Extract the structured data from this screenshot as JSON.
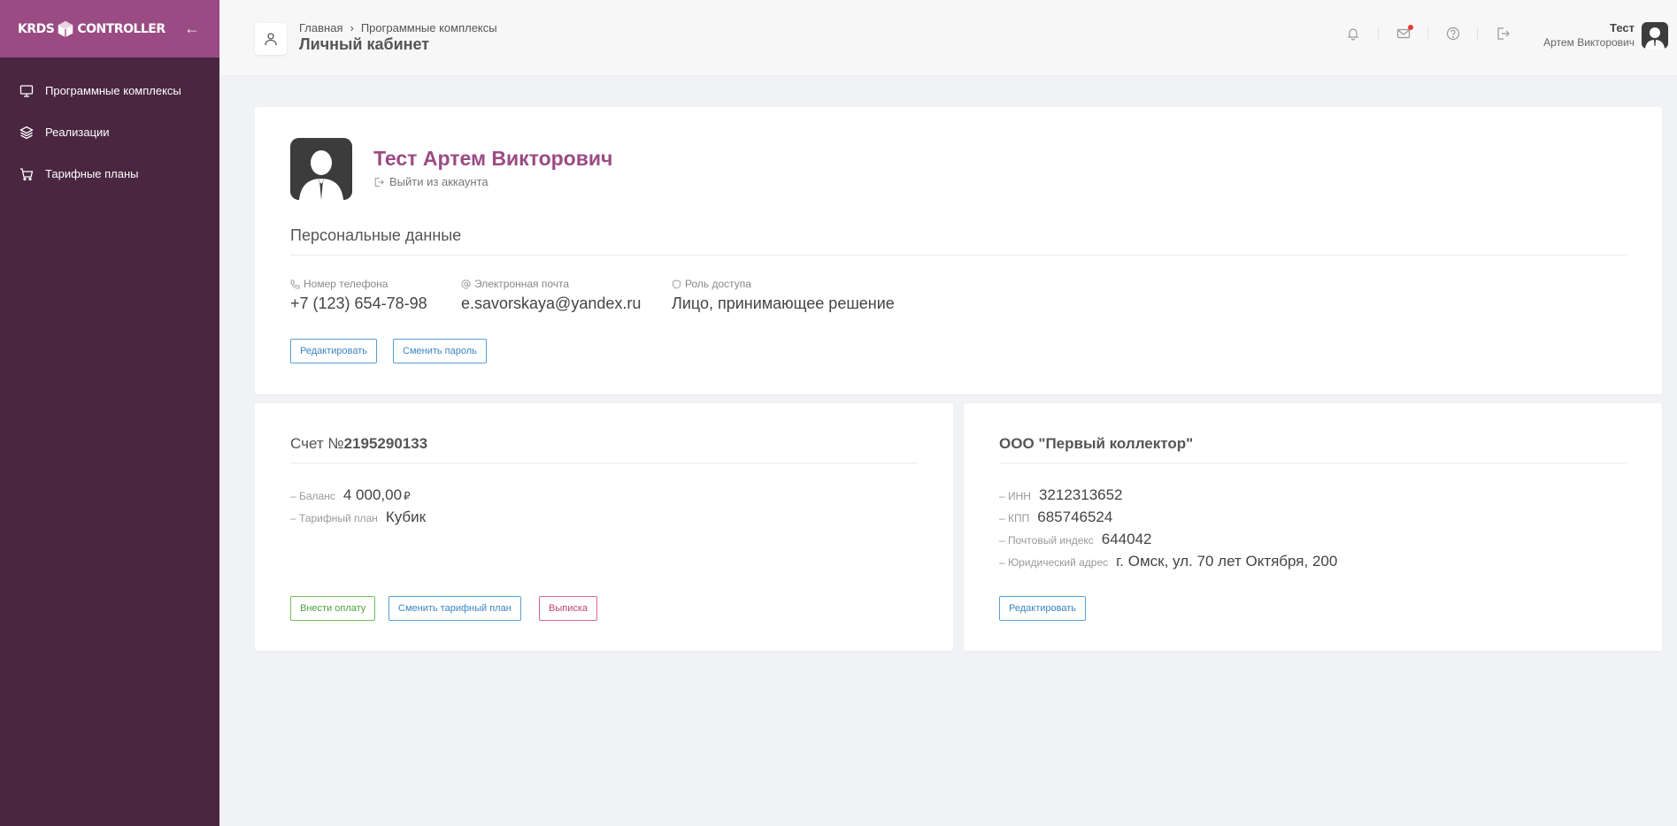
{
  "sidebar": {
    "logo_left": "KRDS",
    "logo_right": "CONTROLLER",
    "items": [
      {
        "label": "Программные комплексы",
        "icon": "monitor-icon"
      },
      {
        "label": "Реализации",
        "icon": "layers-icon"
      },
      {
        "label": "Тарифные планы",
        "icon": "cart-icon"
      }
    ]
  },
  "header": {
    "breadcrumb": [
      "Главная",
      "Программные комплексы"
    ],
    "title": "Личный кабинет",
    "user_first": "Тест",
    "user_full": "Артем Викторович",
    "icons": [
      "bell-icon",
      "mail-icon",
      "help-icon",
      "logout-icon"
    ]
  },
  "profile": {
    "name": "Тест Артем Викторович",
    "logout_label": "Выйти из аккаунта",
    "section_title": "Персональные данные",
    "fields": [
      {
        "label": "Номер телефона",
        "value": "+7 (123) 654-78-98"
      },
      {
        "label": "Электронная почта",
        "value": "e.savorskaya@yandex.ru"
      },
      {
        "label": "Роль доступа",
        "value": "Лицо, принимающее решение"
      }
    ],
    "edit_label": "Редактировать",
    "change_password_label": "Сменить пароль"
  },
  "account": {
    "title_prefix": "Счет №",
    "number": "2195290133",
    "balance_label": "– Баланс",
    "balance_value": "4 000,00",
    "currency": "₽",
    "tariff_label": "– Тарифный план",
    "tariff_value": "Кубик",
    "pay_label": "Внести оплату",
    "change_tariff_label": "Сменить тарифный план",
    "statement_label": "Выписка"
  },
  "company": {
    "title": "ООО \"Первый коллектор\"",
    "rows": [
      {
        "label": "– ИНН",
        "value": "3212313652"
      },
      {
        "label": "– КПП",
        "value": "685746524"
      },
      {
        "label": "– Почтовый индекс",
        "value": "644042"
      },
      {
        "label": "– Юридический адрес",
        "value": "г. Омск, ул. 70 лет Октября, 200"
      }
    ],
    "edit_label": "Редактировать"
  },
  "colors": {
    "sidebar": "#4a2641",
    "sidebar_header": "#9a4b84",
    "accent": "#9a4b84",
    "button_blue": "#3a85c2",
    "button_green": "#4ea33a",
    "button_red": "#c0456b"
  }
}
